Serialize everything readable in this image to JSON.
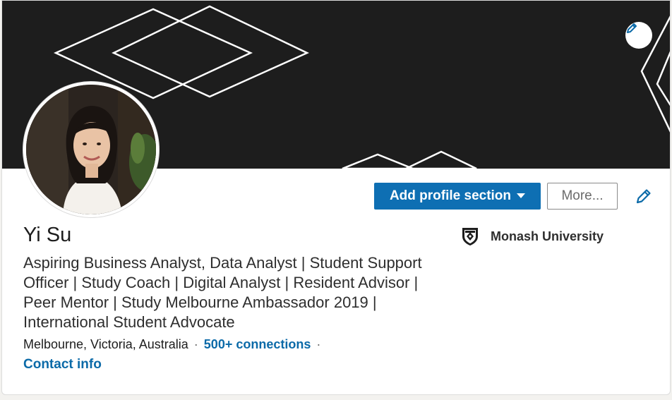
{
  "profile": {
    "name": "Yi Su",
    "headline": "Aspiring Business Analyst, Data Analyst | Student Support Officer | Study Coach | Digital Analyst | Resident Advisor | Peer Mentor | Study Melbourne Ambassador 2019 | International Student Advocate",
    "location": "Melbourne, Victoria, Australia",
    "connections": "500+ connections",
    "contact_info": "Contact info",
    "separator": "·"
  },
  "actions": {
    "add_profile_section": "Add profile section",
    "more": "More..."
  },
  "education": {
    "school": "Monash University"
  },
  "icons": {
    "banner_edit": "pencil-icon",
    "intro_edit": "pencil-icon",
    "dropdown": "caret-down-icon",
    "school_logo": "monash-crest-icon"
  },
  "colors": {
    "primary_button": "#0e6fb3",
    "link": "#0b6aa8",
    "banner": "#1d1d1d"
  }
}
